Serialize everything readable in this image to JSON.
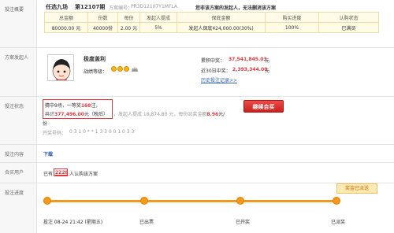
{
  "overview": {
    "label": "投注概要",
    "lottery": "任选九场",
    "issue": "第12107期",
    "plan_no_label": "方案编号：",
    "plan_no": "PR3D12107Y1MFLA",
    "notice": "您非该方案的发起人，无法删消该方案",
    "table": {
      "headers": [
        "总金额",
        "份数",
        "每份",
        "发起人提成",
        "保底金额",
        "购买进度",
        "认购状态"
      ],
      "values": [
        "80000.00 元",
        "40000份",
        "2.00 元",
        "5%",
        "发起人保底¥24,000.00(30%)",
        "100%",
        "已满员"
      ]
    }
  },
  "sponsor": {
    "label": "方案发起人",
    "name": "极度盖利",
    "level_label": "战绩等级：",
    "total_win_label": "累积中奖：",
    "total_win": "37,541,845.03",
    "total_win_unit": "元",
    "recent_win_label": "近30日中奖：",
    "recent_win": "2,393,344.00",
    "recent_win_unit": "元",
    "history_link": "历史投注记录>>"
  },
  "status": {
    "label": "投注状态",
    "line1_prefix": "猜中9场，一等奖",
    "line1_count": "168",
    "line1_suffix": "注，",
    "line2_prefix": "共计",
    "line2_amount": "377,496.00",
    "line2_suffix": "元（税后）",
    "commission": "，发起人提成 18,874.80 元，每份派奖金额",
    "per_share": "8.96",
    "per_share_unit": "元/",
    "per_share_suffix": "份",
    "result_label": "开奖号码：",
    "result_numbers": "0 3 1 0 * * 1 3 3 0 0 1 0 3 3",
    "button": "继续合买"
  },
  "content": {
    "label": "投注内容",
    "download": "下载"
  },
  "joined": {
    "label": "合买用户",
    "prefix": "已有",
    "count": "2228",
    "suffix": "人认购该方案"
  },
  "progress": {
    "label": "投注进度",
    "tag": "奖金已派送",
    "steps": [
      "投注 08-24 21:42 (星期五)",
      "已出票",
      "已开奖",
      "已派奖"
    ]
  }
}
